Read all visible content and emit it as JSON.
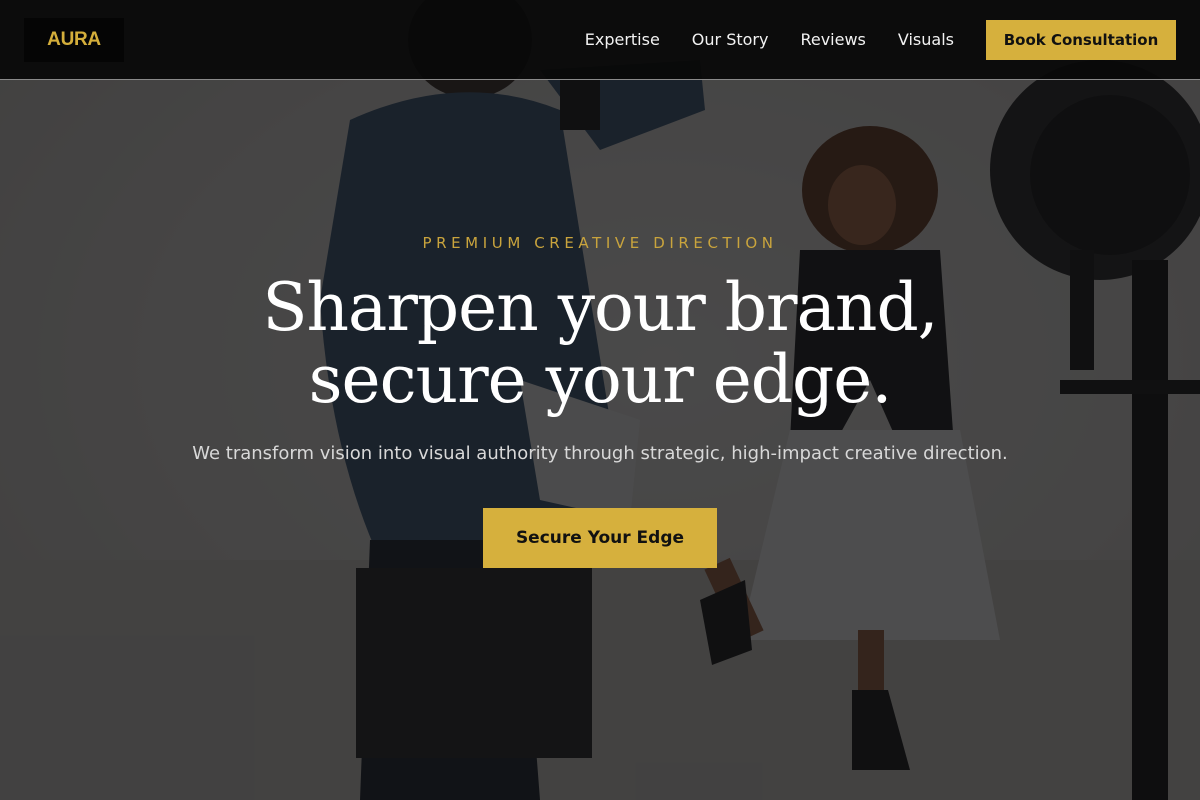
{
  "brand": {
    "logo_text": "AURA"
  },
  "nav": {
    "links": [
      {
        "label": "Expertise"
      },
      {
        "label": "Our Story"
      },
      {
        "label": "Reviews"
      },
      {
        "label": "Visuals"
      }
    ],
    "cta_label": "Book Consultation"
  },
  "hero": {
    "eyebrow": "PREMIUM CREATIVE DIRECTION",
    "headline_line1": "Sharpen your brand,",
    "headline_line2": "secure your edge.",
    "subtext": "We transform vision into visual authority through strategic, high-impact creative direction.",
    "cta_label": "Secure Your Edge"
  },
  "colors": {
    "accent": "#d6b03d",
    "nav_background": "#080808",
    "hero_overlay": "#0c0c0e"
  }
}
